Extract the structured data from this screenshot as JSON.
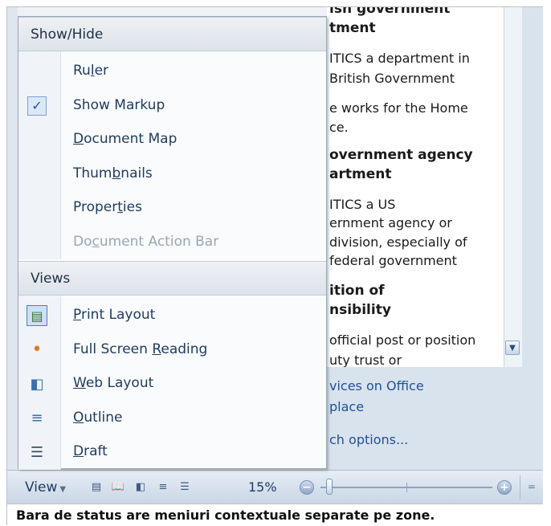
{
  "context_menu": {
    "sections": [
      {
        "header": "Show/Hide",
        "items": [
          {
            "label_parts": [
              "Ru",
              "l",
              "er"
            ],
            "checked": false,
            "disabled": false,
            "icon": ""
          },
          {
            "label_parts": [
              "Show Markup",
              "",
              ""
            ],
            "checked": true,
            "disabled": false,
            "icon": "checkmark-icon"
          },
          {
            "label_parts": [
              "",
              "D",
              "ocument Map"
            ],
            "checked": false,
            "disabled": false,
            "icon": ""
          },
          {
            "label_parts": [
              "Thum",
              "b",
              "nails"
            ],
            "checked": false,
            "disabled": false,
            "icon": ""
          },
          {
            "label_parts": [
              "Proper",
              "t",
              "ies"
            ],
            "checked": false,
            "disabled": false,
            "icon": ""
          },
          {
            "label_parts": [
              "Do",
              "c",
              "ument Action Bar"
            ],
            "checked": false,
            "disabled": true,
            "icon": ""
          }
        ]
      },
      {
        "header": "Views",
        "items": [
          {
            "label_parts": [
              "",
              "P",
              "rint Layout"
            ],
            "selected": true,
            "icon": "print-layout-icon"
          },
          {
            "label_parts": [
              "Full Screen ",
              "R",
              "eading"
            ],
            "icon": "full-screen-reading-icon"
          },
          {
            "label_parts": [
              "",
              "W",
              "eb Layout"
            ],
            "icon": "web-layout-icon"
          },
          {
            "label_parts": [
              "",
              "O",
              "utline"
            ],
            "icon": "outline-icon"
          },
          {
            "label_parts": [
              "",
              "D",
              "raft"
            ],
            "icon": "draft-icon"
          }
        ]
      }
    ]
  },
  "research_pane": {
    "lines": [
      {
        "text": "ish government",
        "bold": true
      },
      {
        "text": "tment",
        "bold": true
      },
      {
        "text": "ITICS  a department in",
        "bold": false
      },
      {
        "text": "British Government",
        "bold": false
      },
      {
        "text": "e works for the Home",
        "bold": false
      },
      {
        "text": "ce.",
        "bold": false
      },
      {
        "text": "overnment agency",
        "bold": true
      },
      {
        "text": "artment",
        "bold": true
      },
      {
        "text": "ITICS  a US",
        "bold": false
      },
      {
        "text": "ernment agency or",
        "bold": false
      },
      {
        "text": "division, especially of",
        "bold": false
      },
      {
        "text": "federal government",
        "bold": false
      },
      {
        "text": "ition of",
        "bold": true
      },
      {
        "text": "nsibility",
        "bold": true
      },
      {
        "text": "official post or position",
        "bold": false
      },
      {
        "text": "uty  trust  or",
        "bold": false
      }
    ],
    "links": [
      "vices on Office",
      "place",
      "ch options..."
    ]
  },
  "status_bar": {
    "view_label": "View",
    "zoom_level": "15%",
    "zoom_fraction": 0.05,
    "view_icons": [
      "print-layout-icon",
      "full-screen-reading-icon",
      "web-layout-icon",
      "outline-icon",
      "draft-icon"
    ]
  },
  "caption": "Bara de status are meniuri contextuale separate pe zone."
}
